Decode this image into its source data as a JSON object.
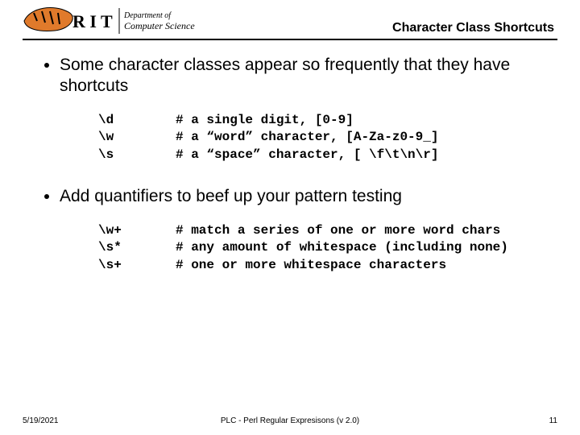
{
  "header": {
    "title": "Character Class Shortcuts",
    "logo_text1": "R I T",
    "logo_text2": "Department of",
    "logo_text3": "Computer Science"
  },
  "bullets": {
    "b1": "Some character classes appear so frequently that they have shortcuts",
    "b2": "Add quantifiers to beef up your pattern testing"
  },
  "block1": {
    "rows": [
      {
        "code": "\\d",
        "comment": "# a single digit, [0-9]"
      },
      {
        "code": "\\w",
        "comment": "# a “word” character, [A-Za-z0-9_]"
      },
      {
        "code": "\\s",
        "comment": "# a “space” character, [ \\f\\t\\n\\r]"
      }
    ]
  },
  "block2": {
    "rows": [
      {
        "code": "\\w+",
        "comment": "# match a series of one or more word chars"
      },
      {
        "code": "\\s*",
        "comment": "# any amount of whitespace (including none)"
      },
      {
        "code": "\\s+",
        "comment": "# one or more whitespace characters"
      }
    ]
  },
  "footer": {
    "date": "5/19/2021",
    "middle": "PLC - Perl Regular Expresisons  (v 2.0)",
    "page": "11"
  }
}
